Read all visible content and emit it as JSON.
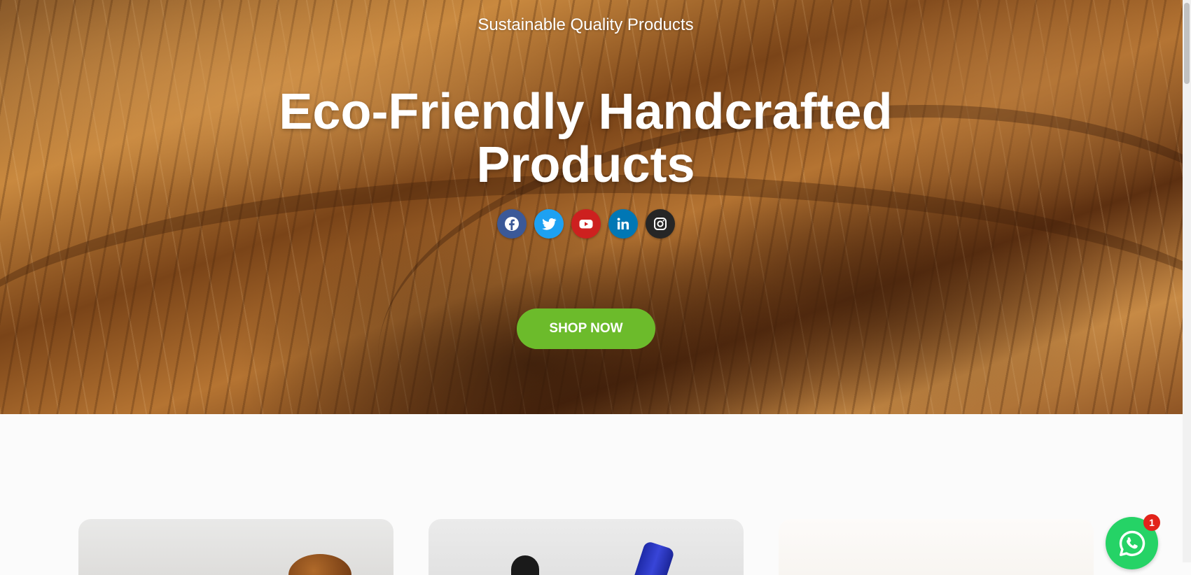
{
  "hero": {
    "tagline": "Sustainable Quality Products",
    "headline_line1": "Eco-Friendly Handcrafted",
    "headline_line2": "Products",
    "cta_label": "SHOP NOW",
    "cta_color": "#6cbb2b"
  },
  "social": [
    {
      "icon": "facebook-icon",
      "color": "#3b5998"
    },
    {
      "icon": "twitter-icon",
      "color": "#1da1f2"
    },
    {
      "icon": "youtube-icon",
      "color": "#cd201f"
    },
    {
      "icon": "linkedin-icon",
      "color": "#0077b5"
    },
    {
      "icon": "instagram-icon",
      "color": "#262626"
    }
  ],
  "whatsapp": {
    "icon": "whatsapp-icon",
    "color": "#25d366",
    "badge_count": "1",
    "badge_color": "#e2231a"
  }
}
